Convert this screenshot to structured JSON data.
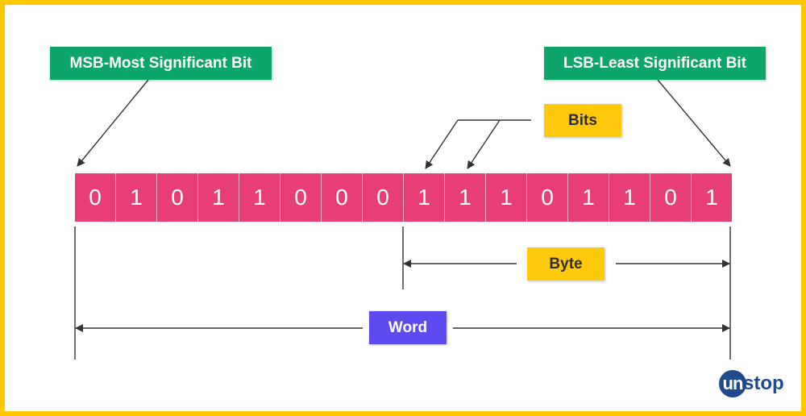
{
  "labels": {
    "msb": "MSB-Most Significant Bit",
    "lsb": "LSB-Least Significant Bit",
    "bits": "Bits",
    "byte": "Byte",
    "word": "Word"
  },
  "bits": [
    "0",
    "1",
    "0",
    "1",
    "1",
    "0",
    "0",
    "0",
    "1",
    "1",
    "1",
    "0",
    "1",
    "1",
    "0",
    "1"
  ],
  "colors": {
    "frame": "#FFC700",
    "bit_cell": "#E83E78",
    "msb_lsb_label": "#0DA56A",
    "bits_byte_label": "#FFC90B",
    "word_label": "#5E4BF0",
    "logo": "#1F4A8C"
  },
  "logo": {
    "circle_text": "un",
    "rest_text": "stop"
  }
}
